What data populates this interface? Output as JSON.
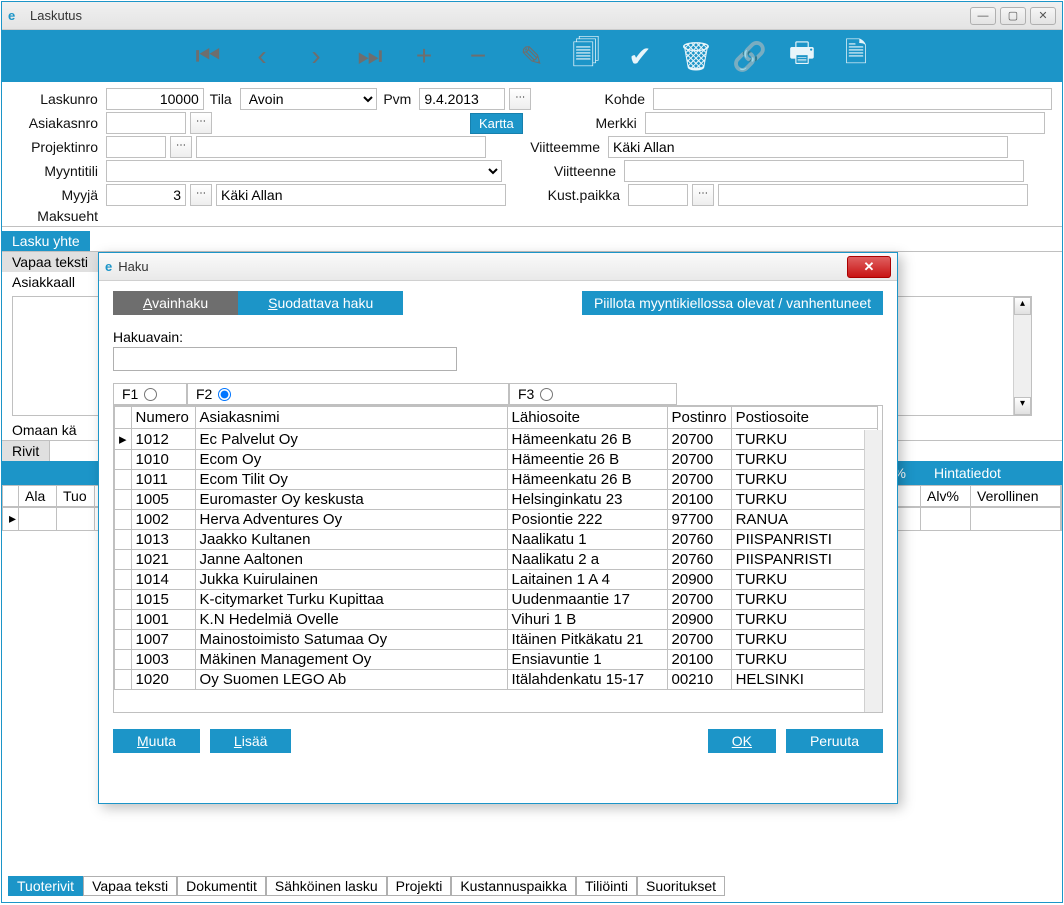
{
  "window": {
    "title": "Laskutus"
  },
  "form": {
    "laskunro_label": "Laskunro",
    "laskunro_value": "10000",
    "tila_label": "Tila",
    "tila_value": "Avoin",
    "pvm_label": "Pvm",
    "pvm_value": "9.4.2013",
    "asiakasnro_label": "Asiakasnro",
    "kartta_label": "Kartta",
    "projektinro_label": "Projektinro",
    "myyntitili_label": "Myyntitili",
    "myyja_label": "Myyjä",
    "myyja_nro": "3",
    "myyja_name": "Käki Allan",
    "kohde_label": "Kohde",
    "merkki_label": "Merkki",
    "viitteemme_label": "Viitteemme",
    "viitteemme_value": "Käki Allan",
    "viitteenne_label": "Viitteenne",
    "kustpaikka_label": "Kust.paikka",
    "maksuehto_label": "Maksueht"
  },
  "sections": {
    "lasku_yhte": "Lasku yhte",
    "vapaa_teksti": "Vapaa teksti",
    "asiakkaalle": "Asiakkaall",
    "omaan_kay": "Omaan kä",
    "rivit": "Rivit"
  },
  "rivit_cols": {
    "alv": "Alv%",
    "hintatiedot": "Hintatiedot",
    "ala": "Ala",
    "tuo": "Tuo",
    "verollinen": "Verollinen"
  },
  "bottom_tabs": [
    "Tuoterivit",
    "Vapaa teksti",
    "Dokumentit",
    "Sähköinen lasku",
    "Projekti",
    "Kustannuspaikka",
    "Tiliöinti",
    "Suoritukset"
  ],
  "dialog": {
    "title": "Haku",
    "tab_avain": "Avainhaku",
    "tab_suodat": "Suodattava haku",
    "hide_btn": "Piillota myyntikiellossa olevat / vanhentuneet",
    "hakuavain_label": "Hakuavain:",
    "hakuavain_value": "",
    "f1": "F1",
    "f2": "F2",
    "f3": "F3",
    "cols": {
      "numero": "Numero",
      "asiakasnimi": "Asiakasnimi",
      "lahiosoite": "Lähiosoite",
      "postinro": "Postinro",
      "postiosoite": "Postiosoite"
    },
    "rows": [
      {
        "numero": "1012",
        "asiakasnimi": "Ec Palvelut Oy",
        "lahiosoite": "Hämeenkatu 26 B",
        "postinro": "20700",
        "postiosoite": "TURKU"
      },
      {
        "numero": "1010",
        "asiakasnimi": "Ecom Oy",
        "lahiosoite": "Hämeentie 26 B",
        "postinro": "20700",
        "postiosoite": "TURKU"
      },
      {
        "numero": "1011",
        "asiakasnimi": "Ecom Tilit Oy",
        "lahiosoite": "Hämeenkatu 26 B",
        "postinro": "20700",
        "postiosoite": "TURKU"
      },
      {
        "numero": "1005",
        "asiakasnimi": "Euromaster Oy keskusta",
        "lahiosoite": "Helsinginkatu 23",
        "postinro": "20100",
        "postiosoite": "TURKU"
      },
      {
        "numero": "1002",
        "asiakasnimi": "Herva Adventures Oy",
        "lahiosoite": "Posiontie 222",
        "postinro": "97700",
        "postiosoite": "RANUA"
      },
      {
        "numero": "1013",
        "asiakasnimi": "Jaakko Kultanen",
        "lahiosoite": "Naalikatu 1",
        "postinro": "20760",
        "postiosoite": "PIISPANRISTI"
      },
      {
        "numero": "1021",
        "asiakasnimi": "Janne Aaltonen",
        "lahiosoite": "Naalikatu 2 a",
        "postinro": "20760",
        "postiosoite": "PIISPANRISTI"
      },
      {
        "numero": "1014",
        "asiakasnimi": "Jukka Kuirulainen",
        "lahiosoite": "Laitainen 1 A 4",
        "postinro": "20900",
        "postiosoite": "TURKU"
      },
      {
        "numero": "1015",
        "asiakasnimi": "K-citymarket Turku Kupittaa",
        "lahiosoite": "Uudenmaantie 17",
        "postinro": "20700",
        "postiosoite": "TURKU"
      },
      {
        "numero": "1001",
        "asiakasnimi": "K.N Hedelmiä Ovelle",
        "lahiosoite": "Vihuri 1 B",
        "postinro": "20900",
        "postiosoite": "TURKU"
      },
      {
        "numero": "1007",
        "asiakasnimi": "Mainostoimisto Satumaa Oy",
        "lahiosoite": "Itäinen Pitkäkatu 21",
        "postinro": "20700",
        "postiosoite": "TURKU"
      },
      {
        "numero": "1003",
        "asiakasnimi": "Mäkinen Management Oy",
        "lahiosoite": "Ensiavuntie 1",
        "postinro": "20100",
        "postiosoite": "TURKU"
      },
      {
        "numero": "1020",
        "asiakasnimi": "Oy Suomen LEGO Ab",
        "lahiosoite": "Itälahdenkatu 15-17",
        "postinro": "00210",
        "postiosoite": "HELSINKI"
      }
    ],
    "btn_muuta": "Muuta",
    "btn_lisaa": "Lisää",
    "btn_ok": "OK",
    "btn_peruuta": "Peruuta"
  }
}
